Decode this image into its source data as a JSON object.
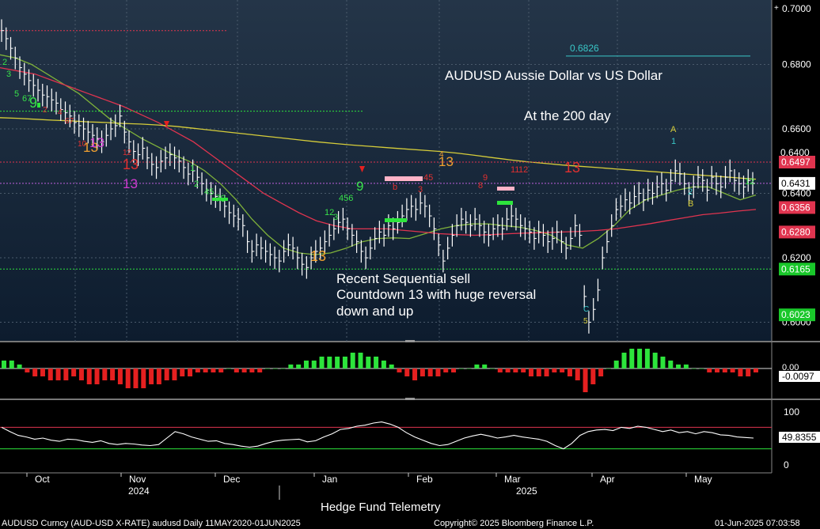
{
  "chart_data": {
    "type": "line",
    "title": "AUDUSD Aussie Dollar vs US Dollar",
    "subtitle": "At the 200 day",
    "annotation": [
      "Recent Sequential sell",
      "Countdown 13 with huge reversal",
      "down and up"
    ],
    "footer_center": "Hedge Fund Telemetry",
    "footer_left": "AUDUSD Curncy (AUD-USD X-RATE) audusd  Daily 11MAY2020-01JUN2025",
    "footer_copyright": "Copyright© 2025 Bloomberg Finance L.P.",
    "footer_date": "01-Jun-2025 07:03:58",
    "price_axis": {
      "ylim": [
        0.594,
        0.7
      ],
      "ticks": [
        {
          "value": 0.68,
          "label": "0.6800"
        },
        {
          "value": 0.66,
          "label": "0.6600"
        },
        {
          "value": 0.64,
          "label": "0.6400"
        },
        {
          "value": 0.62,
          "label": "0.6200"
        },
        {
          "value": 0.6,
          "label": "0.6000"
        }
      ],
      "top_label": "0.7000",
      "scale_handle": "+"
    },
    "month_labels": [
      "Oct",
      "Nov",
      "Dec",
      "Jan",
      "Feb",
      "Mar",
      "Apr",
      "May"
    ],
    "year_labels": [
      "2024",
      "2025"
    ],
    "series": [
      {
        "name": "AUDUSD",
        "color": "#ffffff",
        "values": [
          0.6905,
          0.688,
          0.685,
          0.682,
          0.679,
          0.677,
          0.675,
          0.6735,
          0.672,
          0.6705,
          0.67,
          0.669,
          0.668,
          0.666,
          0.665,
          0.664,
          0.662,
          0.661,
          0.66,
          0.659,
          0.658,
          0.657,
          0.656,
          0.658,
          0.66,
          0.661,
          0.664,
          0.659,
          0.656,
          0.653,
          0.652,
          0.654,
          0.651,
          0.649,
          0.648,
          0.65,
          0.651,
          0.652,
          0.651,
          0.65,
          0.648,
          0.646,
          0.647,
          0.645,
          0.643,
          0.641,
          0.64,
          0.639,
          0.638,
          0.636,
          0.634,
          0.633,
          0.632,
          0.63,
          0.625,
          0.622,
          0.624,
          0.623,
          0.622,
          0.621,
          0.62,
          0.619,
          0.622,
          0.624,
          0.623,
          0.62,
          0.618,
          0.617,
          0.62,
          0.622,
          0.623,
          0.625,
          0.627,
          0.629,
          0.631,
          0.632,
          0.629,
          0.627,
          0.625,
          0.622,
          0.62,
          0.623,
          0.626,
          0.628,
          0.627,
          0.63,
          0.629,
          0.631,
          0.633,
          0.635,
          0.636,
          0.635,
          0.637,
          0.636,
          0.633,
          0.629,
          0.624,
          0.619,
          0.623,
          0.627,
          0.63,
          0.632,
          0.631,
          0.63,
          0.632,
          0.63,
          0.628,
          0.627,
          0.629,
          0.63,
          0.629,
          0.632,
          0.633,
          0.632,
          0.63,
          0.629,
          0.628,
          0.626,
          0.628,
          0.627,
          0.625,
          0.626,
          0.628,
          0.625,
          0.623,
          0.626,
          0.63,
          0.627,
          0.608,
          0.6,
          0.604,
          0.61,
          0.62,
          0.625,
          0.63,
          0.635,
          0.636,
          0.638,
          0.637,
          0.639,
          0.64,
          0.638,
          0.641,
          0.64,
          0.642,
          0.643,
          0.641,
          0.644,
          0.647,
          0.646,
          0.643,
          0.64,
          0.642,
          0.645,
          0.644,
          0.641,
          0.645,
          0.643,
          0.642,
          0.645,
          0.647,
          0.644,
          0.643,
          0.642,
          0.644,
          0.6431
        ]
      },
      {
        "name": "MA short",
        "color": "#7fb23a",
        "values": [
          0.683,
          0.682,
          0.68,
          0.677,
          0.674,
          0.671,
          0.667,
          0.663,
          0.66,
          0.657,
          0.6545,
          0.652,
          0.65,
          0.647,
          0.643,
          0.638,
          0.632,
          0.627,
          0.623,
          0.6215,
          0.621,
          0.6215,
          0.623,
          0.625,
          0.626,
          0.6262,
          0.626,
          0.6275,
          0.629,
          0.63,
          0.6305,
          0.6305,
          0.63,
          0.6295,
          0.6285,
          0.627,
          0.624,
          0.623,
          0.626,
          0.63,
          0.635,
          0.638,
          0.6395,
          0.641,
          0.642,
          0.642,
          0.64,
          0.638,
          0.6395
        ]
      },
      {
        "name": "MA mid",
        "color": "#e0344f",
        "values": [
          0.679,
          0.678,
          0.677,
          0.675,
          0.673,
          0.671,
          0.669,
          0.667,
          0.6645,
          0.662,
          0.659,
          0.656,
          0.652,
          0.648,
          0.644,
          0.64,
          0.637,
          0.634,
          0.6315,
          0.63,
          0.629,
          0.629,
          0.629,
          0.6285,
          0.628,
          0.6275,
          0.6272,
          0.627,
          0.6272,
          0.6275,
          0.6277,
          0.6278,
          0.628,
          0.6282,
          0.6285,
          0.629,
          0.6298,
          0.6306,
          0.6316,
          0.6325,
          0.6334,
          0.6339,
          0.6345,
          0.635
        ]
      },
      {
        "name": "MA 200",
        "color": "#d6cd3a",
        "values": [
          0.6635,
          0.6633,
          0.663,
          0.6627,
          0.6625,
          0.6622,
          0.662,
          0.6617,
          0.6615,
          0.6612,
          0.6608,
          0.6602,
          0.6596,
          0.659,
          0.6584,
          0.6578,
          0.6572,
          0.6566,
          0.656,
          0.6555,
          0.655,
          0.6546,
          0.6542,
          0.6538,
          0.6534,
          0.653,
          0.6525,
          0.6518,
          0.6511,
          0.6504,
          0.6498,
          0.6493,
          0.6488,
          0.6484,
          0.648,
          0.6476,
          0.6472,
          0.6468,
          0.6464,
          0.646,
          0.6456,
          0.6452,
          0.6448,
          0.6444
        ]
      }
    ],
    "right_price_labels": [
      {
        "value": 0.6497,
        "label": "0.6497",
        "bg": "#e0344f",
        "fg": "#ffffff"
      },
      {
        "value": 0.6431,
        "label": "0.6431",
        "bg": "#ffffff",
        "fg": "#000000"
      },
      {
        "value": 0.6356,
        "label": "0.6356",
        "bg": "#e0344f",
        "fg": "#ffffff"
      },
      {
        "value": 0.628,
        "label": "0.6280",
        "bg": "#e0344f",
        "fg": "#ffffff"
      },
      {
        "value": 0.6165,
        "label": "0.6165",
        "bg": "#19c72a",
        "fg": "#ffffff"
      },
      {
        "value": 0.6023,
        "label": "0.6023",
        "bg": "#19c72a",
        "fg": "#ffffff"
      }
    ],
    "price_label_overlap": "0.6400",
    "levels": [
      {
        "label": "0.6826",
        "value": 0.6826,
        "color": "#39c7c7"
      }
    ],
    "osc1": {
      "current": "-0.0097",
      "zero_label": "0.00",
      "values": [
        2,
        2,
        1,
        -1,
        -2,
        -2,
        -3,
        -3,
        -3,
        -2,
        -3,
        -4,
        -4,
        -3,
        -3,
        -4,
        -5,
        -5,
        -5,
        -4,
        -4,
        -3,
        -3,
        -2,
        -2,
        -1,
        -1,
        -1,
        -1,
        0,
        -1,
        -1,
        -1,
        -1,
        0,
        0,
        0,
        1,
        1,
        2,
        2,
        3,
        3,
        3,
        3,
        4,
        4,
        3,
        3,
        2,
        1,
        -1,
        -2,
        -3,
        -2,
        -2,
        -2,
        -1,
        -1,
        0,
        0,
        1,
        1,
        0,
        -1,
        -1,
        -1,
        -1,
        -2,
        -2,
        -2,
        -1,
        -1,
        -2,
        -3,
        -6,
        -4,
        -2,
        0,
        2,
        4,
        5,
        5,
        5,
        4,
        3,
        2,
        1,
        1,
        0,
        0,
        -1,
        -1,
        -1,
        -1,
        -2,
        -2,
        -1
      ]
    },
    "osc2": {
      "current": "49.8355",
      "axis": [
        {
          "value": 100,
          "label": "100"
        },
        {
          "value": 0,
          "label": "0"
        }
      ],
      "upper": 70,
      "lower": 30,
      "values": [
        70,
        62,
        55,
        52,
        48,
        50,
        46,
        44,
        48,
        47,
        44,
        42,
        45,
        40,
        38,
        40,
        39,
        37,
        36,
        38,
        50,
        62,
        58,
        52,
        48,
        44,
        45,
        40,
        38,
        35,
        33,
        35,
        40,
        44,
        46,
        47,
        48,
        43,
        45,
        52,
        58,
        66,
        68,
        72,
        74,
        78,
        80,
        76,
        70,
        60,
        52,
        46,
        40,
        36,
        38,
        44,
        50,
        54,
        57,
        54,
        50,
        52,
        55,
        52,
        50,
        48,
        44,
        36,
        30,
        40,
        55,
        62,
        65,
        66,
        64,
        70,
        68,
        72,
        70,
        66,
        62,
        65,
        60,
        62,
        58,
        62,
        60,
        56,
        55,
        52,
        51,
        50
      ]
    }
  }
}
